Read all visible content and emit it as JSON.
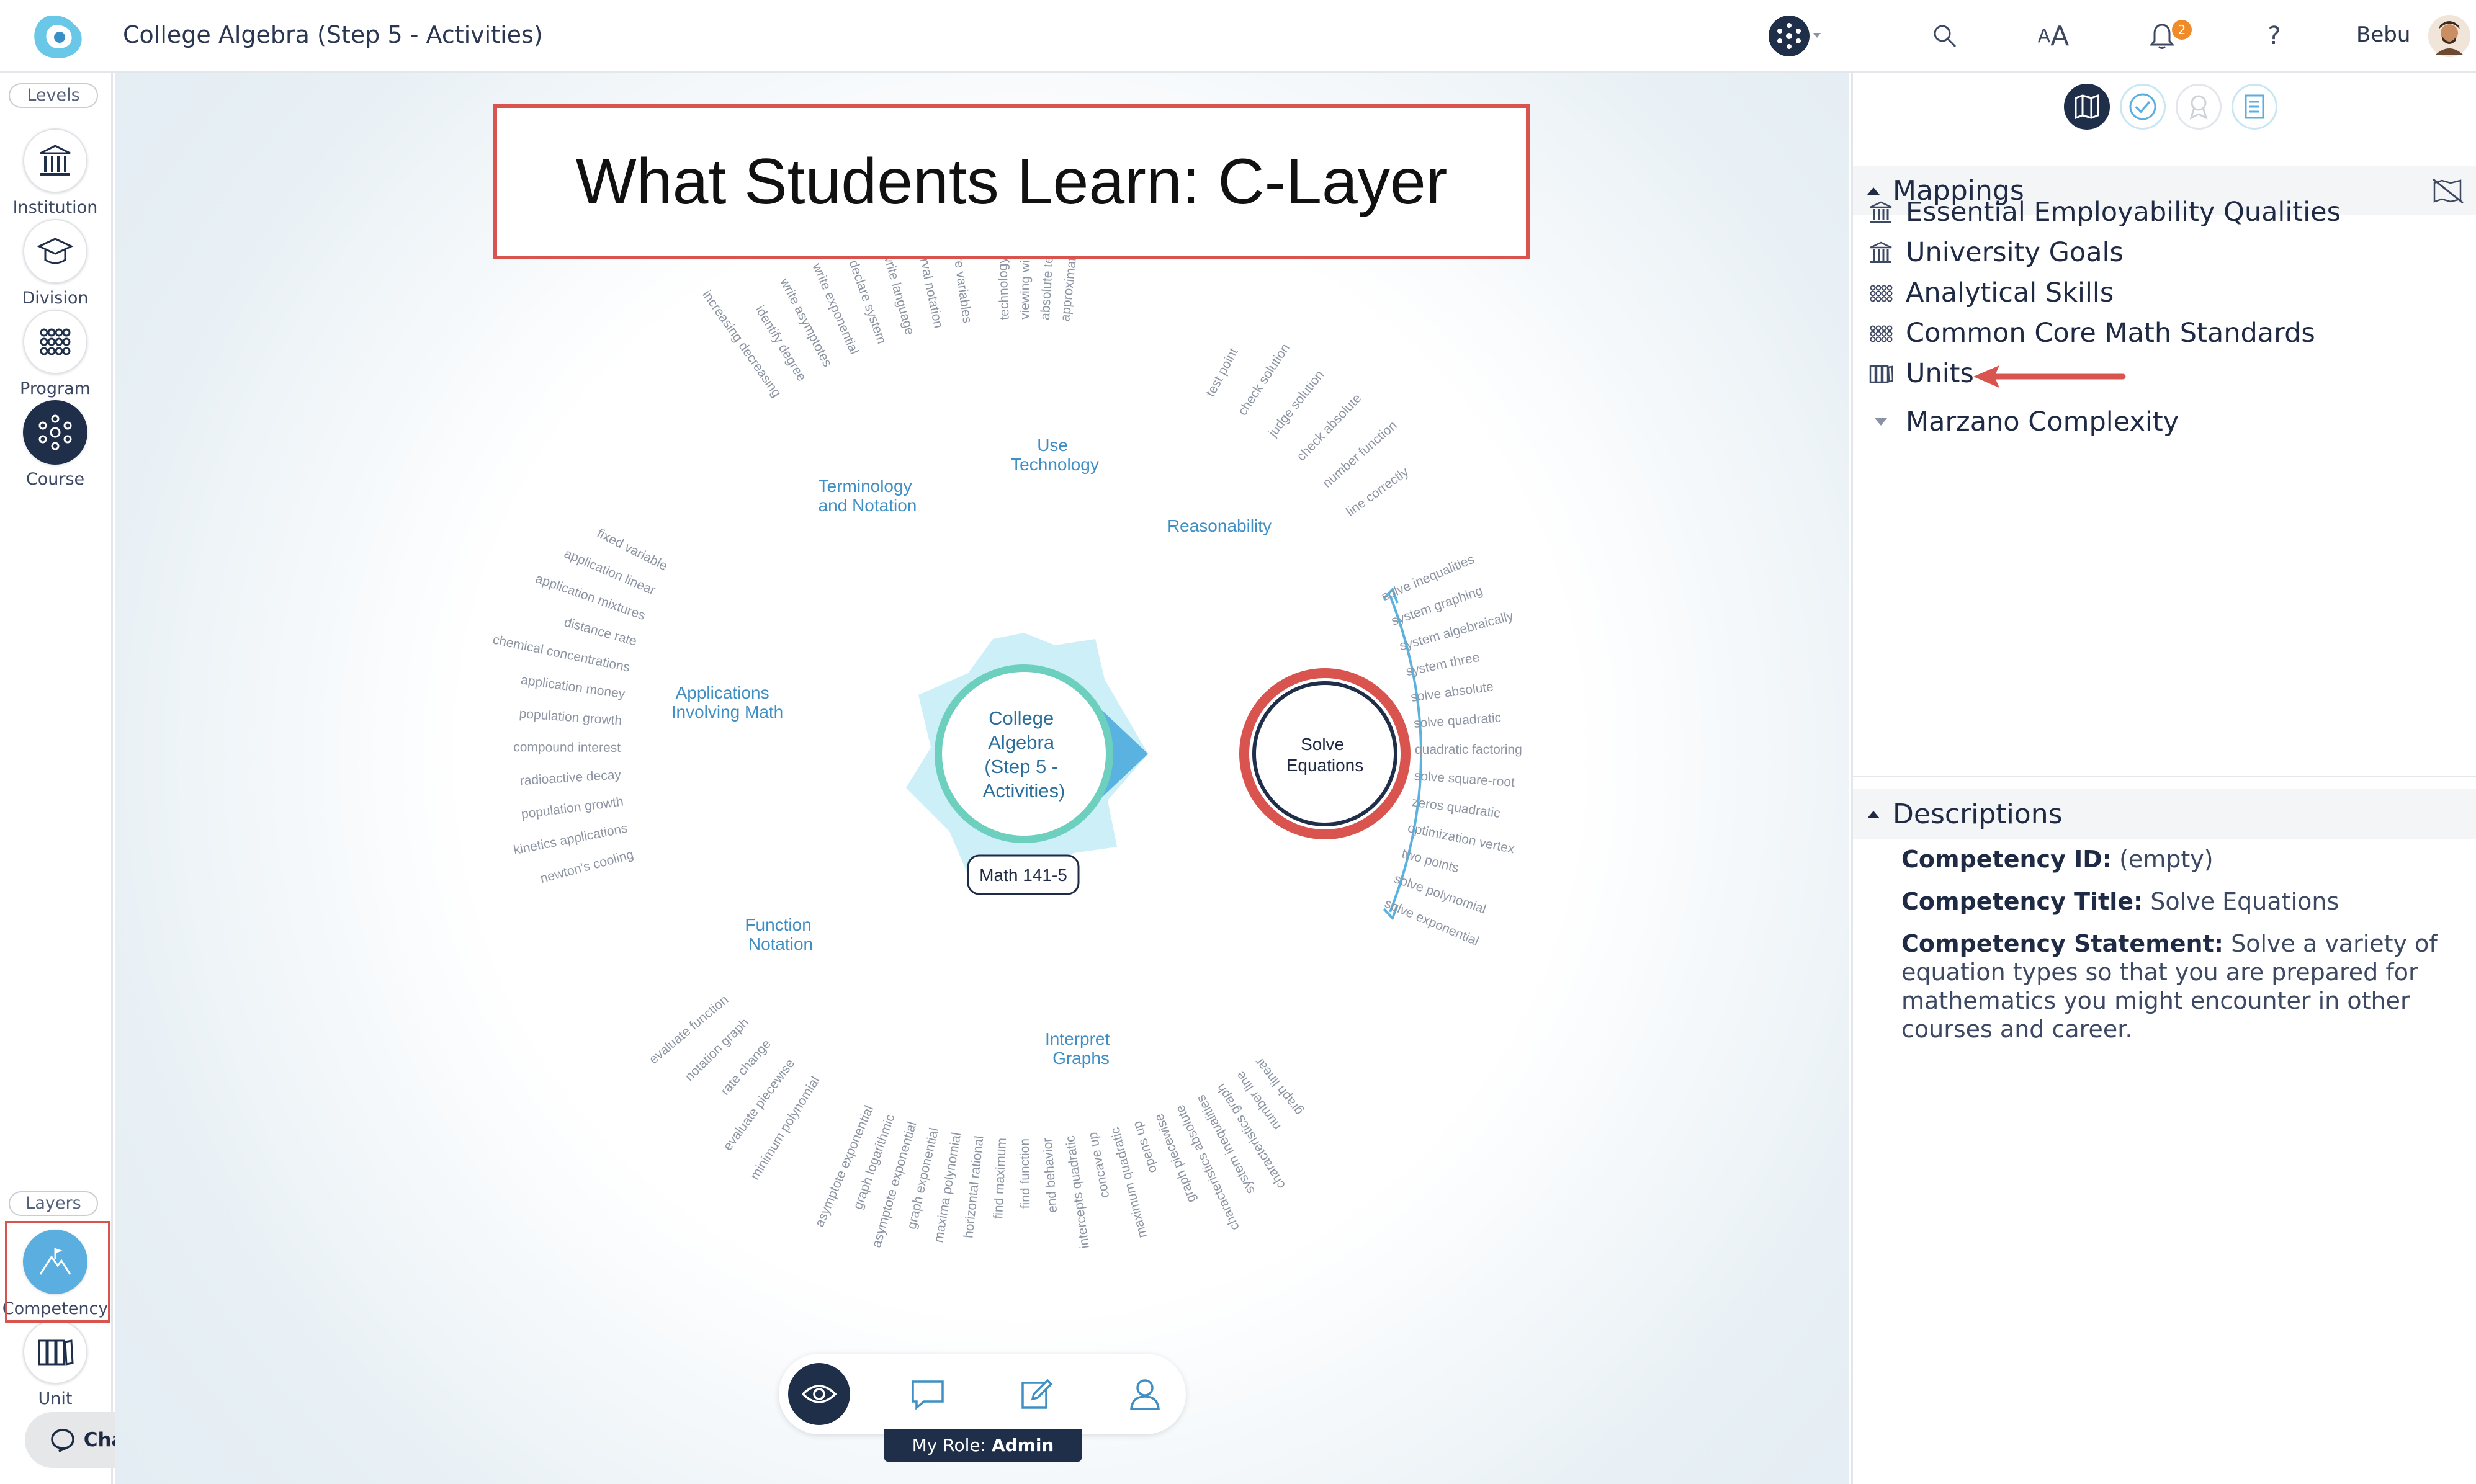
{
  "header": {
    "title": "College Algebra (Step 5 - Activities)",
    "notifications": "2",
    "user": "Bebu"
  },
  "sidebar": {
    "levels_label": "Levels",
    "levels": [
      "Institution",
      "Division",
      "Program",
      "Course"
    ],
    "layers_label": "Layers",
    "layers": [
      "Competency",
      "Unit"
    ],
    "chat": "Chat"
  },
  "callout": "What Students Learn: C-Layer",
  "map": {
    "center_title": [
      "College",
      "Algebra",
      "(Step 5 -",
      "Activities)"
    ],
    "course_code": "Math 141-5",
    "selected": [
      "Solve",
      "Equations"
    ],
    "categories": [
      {
        "lines": [
          "Terminology",
          "and Notation"
        ]
      },
      {
        "lines": [
          "Use",
          "Technology"
        ]
      },
      {
        "lines": [
          "Reasonability"
        ]
      },
      {
        "lines": [
          "Applications",
          "Involving Math"
        ]
      },
      {
        "lines": [
          "Function",
          "Notation"
        ]
      },
      {
        "lines": [
          "Interpret",
          "Graphs"
        ]
      }
    ],
    "solve_items": [
      "solve inequalities",
      "system graphing",
      "system algebraically",
      "system three",
      "solve absolute",
      "solve quadratic",
      "quadratic factoring",
      "solve square-root",
      "zeros quadratic",
      "optimization vertex",
      "two points",
      "solve polynomial",
      "solve exponential"
    ],
    "reason_items": [
      "test point",
      "check solution",
      "judge solution",
      "check absolute",
      "number function",
      "line correctly"
    ],
    "apps_items": [
      "fixed variable",
      "application linear",
      "application mixtures",
      "distance rate",
      "chemical concentrations",
      "application money",
      "population growth",
      "compound interest",
      "radioactive decay",
      "population growth",
      "kinetics applications",
      "newton's cooling"
    ],
    "term_items": [
      "increasing decreasing",
      "identify degree",
      "write asymptotes",
      "write exponential",
      "declare system",
      "write language",
      "interval notation",
      "declare variables"
    ],
    "tech_items": [
      "technology",
      "viewing window",
      "absolute technology",
      "approximate"
    ],
    "func_items": [
      "evaluate function",
      "notation graph",
      "rate change",
      "evaluate piecewise",
      "minimum polynomial"
    ],
    "graph_items": [
      "asymptote exponential",
      "graph logarithmic",
      "asymptote exponential",
      "graph exponential",
      "maxima polynomial",
      "horizontal rational",
      "find maximum",
      "find function",
      "end behavior",
      "intercepts quadratic",
      "concave up",
      "maximum quadratic",
      "opens up",
      "graph piecewise",
      "characteristics absolute",
      "system inequalities",
      "characteristics graph",
      "number line",
      "graph linear"
    ]
  },
  "role": {
    "label": "My Role:",
    "value": "Admin"
  },
  "right_panel": {
    "mappings_title": "Mappings",
    "mappings": [
      "Essential Employability Qualities",
      "University Goals",
      "Analytical Skills",
      "Common Core Math Standards",
      "Units"
    ],
    "marzano": "Marzano Complexity",
    "descriptions_title": "Descriptions",
    "comp_id_label": "Competency ID:",
    "comp_id": "(empty)",
    "comp_title_label": "Competency Title:",
    "comp_title": "Solve Equations",
    "comp_statement_label": "Competency Statement:",
    "comp_statement": "Solve a variety of equation types so that you are prepared for mathematics you might encounter in other courses and career."
  },
  "colors": {
    "accent": "#5aaee0",
    "navy": "#1f2f4a",
    "red": "#d9534f",
    "teal": "#6dcfbe",
    "orange": "#f08b2c"
  }
}
